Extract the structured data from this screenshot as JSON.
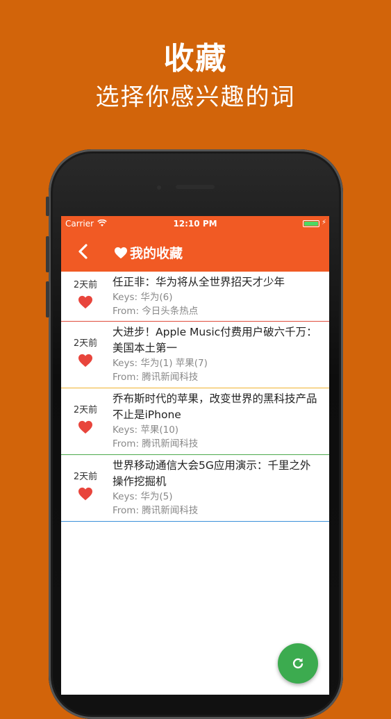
{
  "promo": {
    "title": "收藏",
    "subtitle": "选择你感兴趣的词"
  },
  "status_bar": {
    "carrier": "Carrier",
    "time": "12:10 PM"
  },
  "nav": {
    "title": "我的收藏"
  },
  "colors": {
    "background": "#d2640a",
    "nav_bar": "#f15a24",
    "heart": "#e8453c",
    "fab": "#3cab4f"
  },
  "news": [
    {
      "time": "2天前",
      "title": "任正非：华为将从全世界招天才少年",
      "keys": "Keys: 华为(6)",
      "from": "From: 今日头条热点",
      "divider_color": "#e04b3c"
    },
    {
      "time": "2天前",
      "title": "大进步！Apple Music付费用户破六千万：美国本土第一",
      "keys": "Keys: 华为(1) 苹果(7)",
      "from": "From: 腾讯新闻科技",
      "divider_color": "#f0b22e"
    },
    {
      "time": "2天前",
      "title": "乔布斯时代的苹果，改变世界的黑科技产品不止是iPhone",
      "keys": "Keys: 苹果(10)",
      "from": "From: 腾讯新闻科技",
      "divider_color": "#4aa84a"
    },
    {
      "time": "2天前",
      "title": "世界移动通信大会5G应用演示：千里之外操作挖掘机",
      "keys": "Keys: 华为(5)",
      "from": "From: 腾讯新闻科技",
      "divider_color": "#3a8fd9"
    }
  ],
  "fab": {
    "icon": "refresh-icon"
  }
}
